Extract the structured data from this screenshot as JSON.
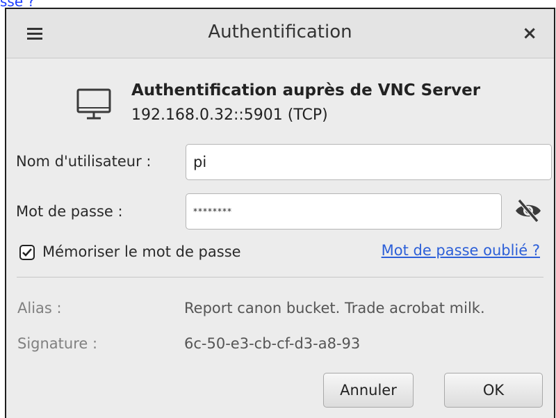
{
  "background": {
    "link_fragment": "sse ?"
  },
  "dialog": {
    "title": "Authentification",
    "close_label": "×",
    "header": {
      "title": "Authentification auprès de VNC Server",
      "address": "192.168.0.32::5901 (TCP)"
    },
    "username": {
      "label": "Nom d'utilisateur :",
      "value": "pi"
    },
    "password": {
      "label": "Mot de passe :",
      "value": "********"
    },
    "remember": {
      "label": "Mémoriser le mot de passe",
      "checked": true
    },
    "forgot_link": "Mot de passe oublié ?",
    "alias": {
      "label": "Alias :",
      "value": "Report canon bucket. Trade acrobat milk."
    },
    "signature": {
      "label": "Signature :",
      "value": "6c-50-e3-cb-cf-d3-a8-93"
    },
    "buttons": {
      "cancel": "Annuler",
      "ok": "OK"
    }
  },
  "icons": {
    "menu": "hamburger-icon",
    "close": "close-icon",
    "monitor": "monitor-icon",
    "reveal": "eye-slash-icon",
    "check": "checkmark-icon"
  },
  "colors": {
    "link": "#2c5fd8",
    "dialog_bg": "#ececec",
    "titlebar_bg": "#e4e4e4"
  }
}
